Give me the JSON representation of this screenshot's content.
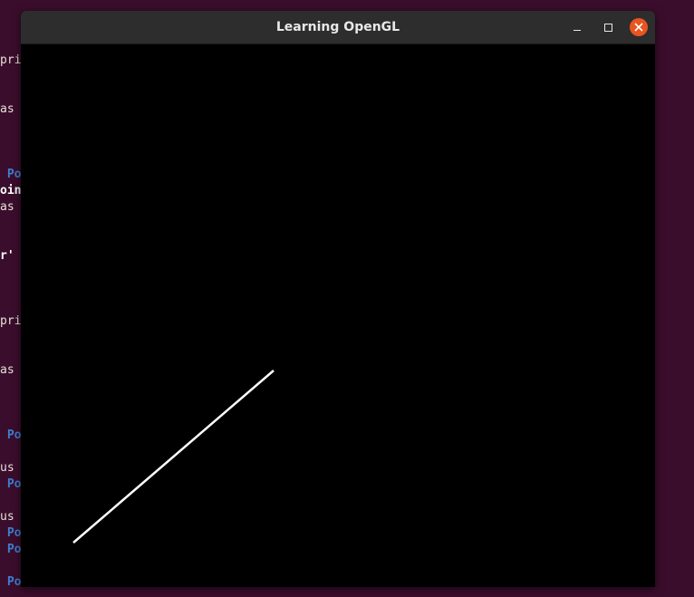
{
  "window": {
    "title": "Learning OpenGL",
    "close_color": "#e95420"
  },
  "terminal_fragments": [
    {
      "text": "pri",
      "style": ""
    },
    {
      "text": "as",
      "style": ""
    },
    {
      "text": " Po",
      "style": "blue"
    },
    {
      "text": "oin",
      "style": "bold"
    },
    {
      "text": "as",
      "style": ""
    },
    {
      "text": "r'",
      "style": "bold"
    },
    {
      "text": "pri",
      "style": ""
    },
    {
      "text": "as",
      "style": ""
    },
    {
      "text": " Po",
      "style": "blue"
    },
    {
      "text": "us",
      "style": ""
    },
    {
      "text": " Po",
      "style": "blue"
    },
    {
      "text": "us",
      "style": ""
    },
    {
      "text": " Po",
      "style": "blue"
    },
    {
      "text": " Po",
      "style": "blue"
    },
    {
      "text": " Po",
      "style": "blue"
    }
  ],
  "drawn_line": {
    "color": "#ffffff"
  }
}
